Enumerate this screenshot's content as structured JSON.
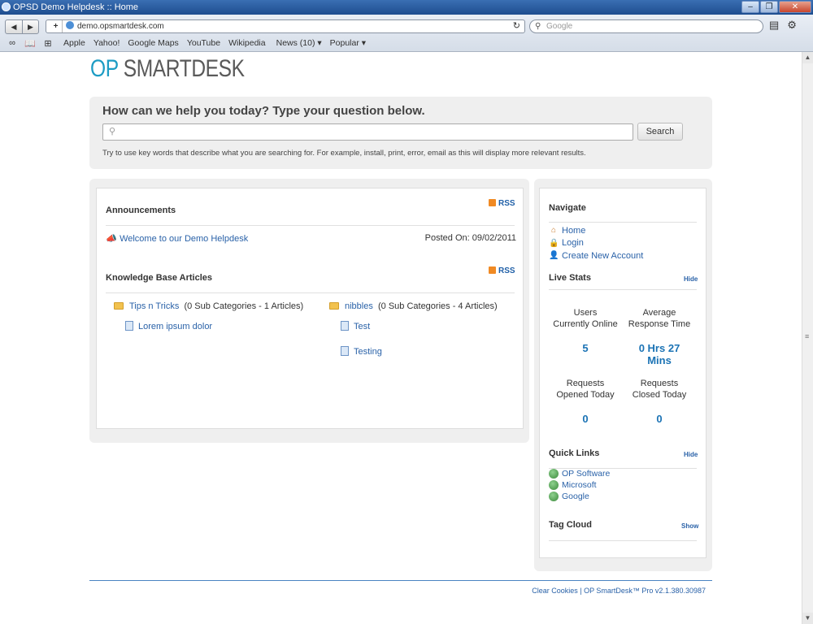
{
  "window": {
    "title": "OPSD Demo Helpdesk :: Home"
  },
  "browser": {
    "url": "demo.opsmartdesk.com",
    "search_placeholder": "Google",
    "bookmarks": [
      "Apple",
      "Yahoo!",
      "Google Maps",
      "YouTube",
      "Wikipedia",
      "News (10) ▾",
      "Popular ▾"
    ]
  },
  "logo": {
    "op": "OP",
    "rest": "SMARTDESK"
  },
  "search": {
    "heading": "How can we help you today? Type your question below.",
    "button": "Search",
    "hint": "Try to use key words that describe what you are searching for. For example, install, print, error, email as this will display more relevant results."
  },
  "announcements": {
    "title": "Announcements",
    "rss": "RSS",
    "item": "Welcome to our Demo Helpdesk",
    "posted": "Posted On: 09/02/2011"
  },
  "kb": {
    "title": "Knowledge Base Articles",
    "rss": "RSS",
    "categories": [
      {
        "name": "Tips n Tricks",
        "info": "(0 Sub Categories - 1 Articles)",
        "articles": [
          "Lorem ipsum dolor"
        ]
      },
      {
        "name": "nibbles",
        "info": "(0 Sub Categories - 4 Articles)",
        "articles": [
          "Test",
          "Testing"
        ]
      }
    ]
  },
  "navigate": {
    "title": "Navigate",
    "items": [
      "Home",
      "Login",
      "Create New Account"
    ]
  },
  "live_stats": {
    "title": "Live Stats",
    "hide": "Hide",
    "users_label_1": "Users",
    "users_label_2": "Currently Online",
    "users_value": "5",
    "resp_label_1": "Average",
    "resp_label_2": "Response Time",
    "resp_value_1": "0 Hrs 27",
    "resp_value_2": "Mins",
    "opened_label_1": "Requests",
    "opened_label_2": "Opened Today",
    "opened_value": "0",
    "closed_label_1": "Requests",
    "closed_label_2": "Closed Today",
    "closed_value": "0"
  },
  "quick_links": {
    "title": "Quick Links",
    "hide": "Hide",
    "items": [
      "OP Software",
      "Microsoft",
      "Google"
    ]
  },
  "tag_cloud": {
    "title": "Tag Cloud",
    "show": "Show"
  },
  "footer": {
    "text": "Clear Cookies | OP SmartDesk™ Pro v2.1.380.30987"
  }
}
